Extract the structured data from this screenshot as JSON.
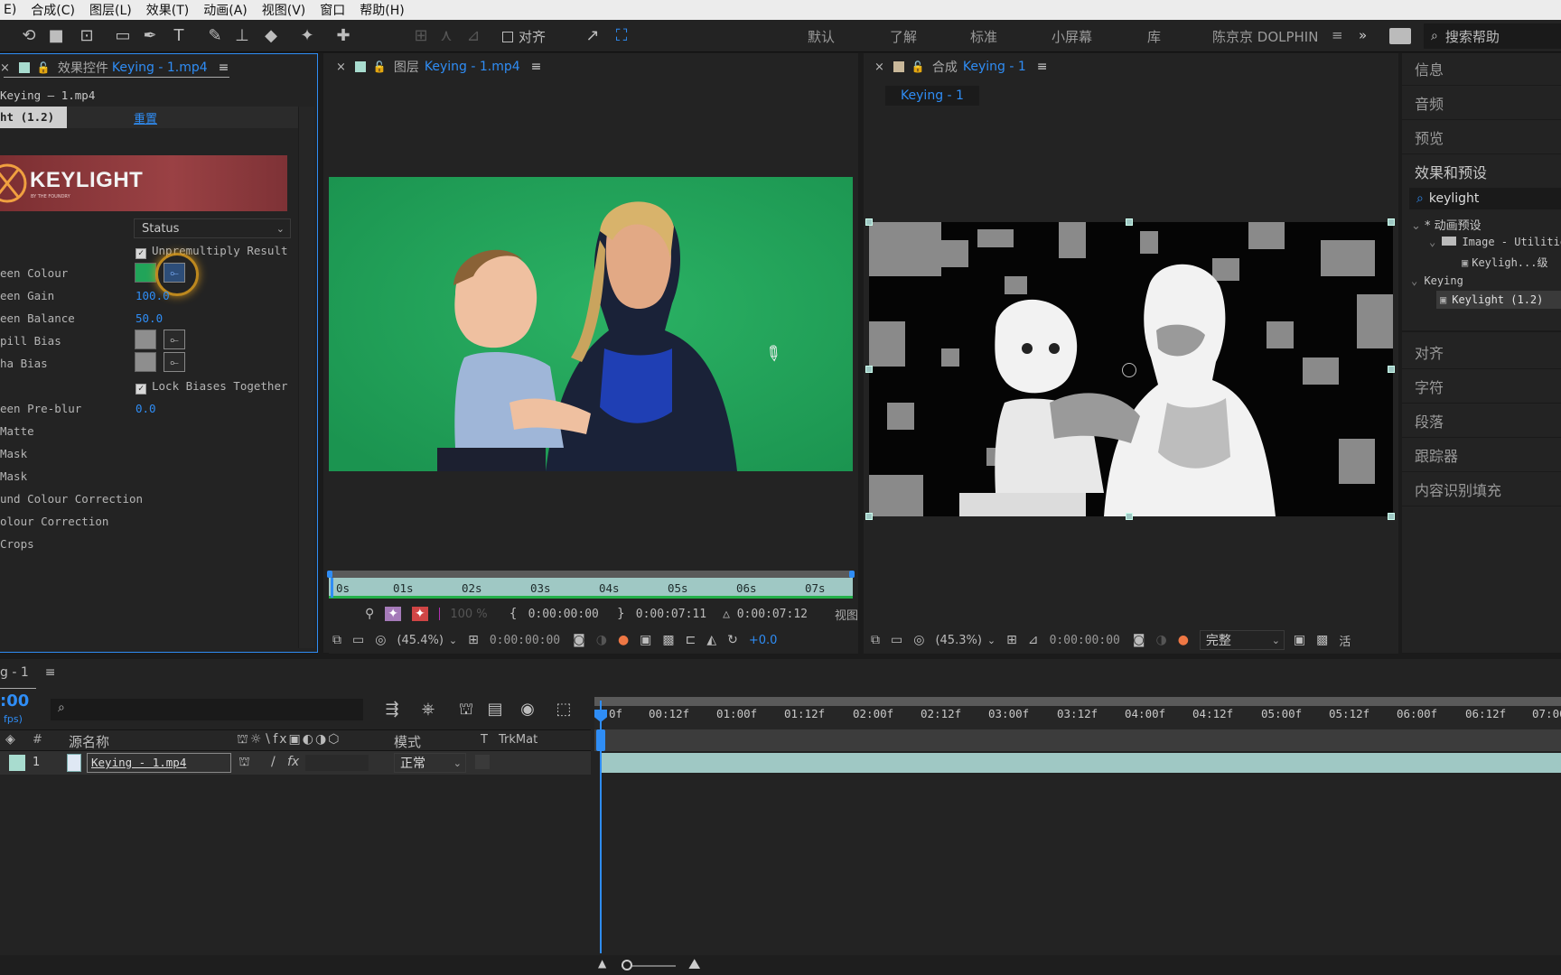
{
  "menu": [
    "E)",
    "合成(C)",
    "图层(L)",
    "效果(T)",
    "动画(A)",
    "视图(V)",
    "窗口",
    "帮助(H)"
  ],
  "toolbar": {
    "align_label": "对齐",
    "workspaces": [
      "默认",
      "了解",
      "标准",
      "小屏幕",
      "库"
    ],
    "user_workspace": "陈京京 DOLPHIN",
    "search_placeholder": "搜索帮助"
  },
  "effect_panel": {
    "tab_prefix": "效果控件",
    "tab_file": "Keying - 1.mp4",
    "layer_path": "Keying – 1.mp4",
    "effect_name": "ht (1.2)",
    "reset_label": "重置",
    "logo_text": "KEYLIGHT",
    "logo_sub": "BY THE FOUNDRY",
    "view_dropdown": "Status",
    "params": [
      {
        "label": "",
        "value": "Unpremultiply Result"
      },
      {
        "label": "een Colour",
        "value": ""
      },
      {
        "label": "een Gain",
        "value": "100.0"
      },
      {
        "label": "een Balance",
        "value": "50.0"
      },
      {
        "label": "pill Bias",
        "value": ""
      },
      {
        "label": "ha Bias",
        "value": ""
      },
      {
        "label": "",
        "value": "Lock Biases Together"
      },
      {
        "label": "een Pre-blur",
        "value": "0.0"
      },
      {
        "label": "Matte",
        "value": ""
      },
      {
        "label": "Mask",
        "value": ""
      },
      {
        "label": " Mask",
        "value": ""
      },
      {
        "label": "und Colour Correction",
        "value": ""
      },
      {
        "label": "olour Correction",
        "value": ""
      },
      {
        "label": "Crops",
        "value": ""
      }
    ]
  },
  "layer_viewer": {
    "tab_prefix": "图层",
    "tab_file": "Keying - 1.mp4",
    "ruler": [
      "0s",
      "01s",
      "02s",
      "03s",
      "04s",
      "05s",
      "06s",
      "07s"
    ],
    "opacity": "100 %",
    "in_time": "0:00:00:00",
    "out_time": "0:00:07:11",
    "duration": "△ 0:00:07:12",
    "view_label": "视图",
    "zoom": "(45.4%)",
    "current_time": "0:00:00:00",
    "exposure": "+0.0"
  },
  "comp_viewer": {
    "tab_prefix": "合成",
    "tab_name": "Keying - 1",
    "subtab": "Keying - 1",
    "zoom": "(45.3%)",
    "current_time": "0:00:00:00",
    "quality": "完整",
    "extra": "活"
  },
  "right_panel": {
    "sections_top": [
      "信息",
      "音频",
      "预览",
      "效果和预设"
    ],
    "search_value": "keylight",
    "tree": {
      "anim_presets": "* 动画预设",
      "image_util": "Image - Utilitie",
      "keylight_preset": "Keyligh...级",
      "keying": "Keying",
      "keylight_effect": "Keylight (1.2)"
    },
    "sections_bottom": [
      "对齐",
      "字符",
      "段落",
      "跟踪器",
      "内容识别填充"
    ]
  },
  "timeline": {
    "comp_tab": "g - 1",
    "timecode": ":00",
    "fps": "fps)",
    "col_num": "#",
    "col_source": "源名称",
    "col_mode": "模式",
    "col_t": "T",
    "col_trkmat": "TrkMat",
    "layer_index": "1",
    "layer_name": "Keying - 1.mp4",
    "layer_mode": "正常",
    "ticks": [
      "0f",
      "00:12f",
      "01:00f",
      "01:12f",
      "02:00f",
      "02:12f",
      "03:00f",
      "03:12f",
      "04:00f",
      "04:12f",
      "05:00f",
      "05:12f",
      "06:00f",
      "06:12f",
      "07:00"
    ]
  },
  "colors": {
    "accent": "#2f8df5",
    "green_screen": "#21a459",
    "layer_bar": "#9fc8c4",
    "label_teal": "#a8dccf"
  }
}
